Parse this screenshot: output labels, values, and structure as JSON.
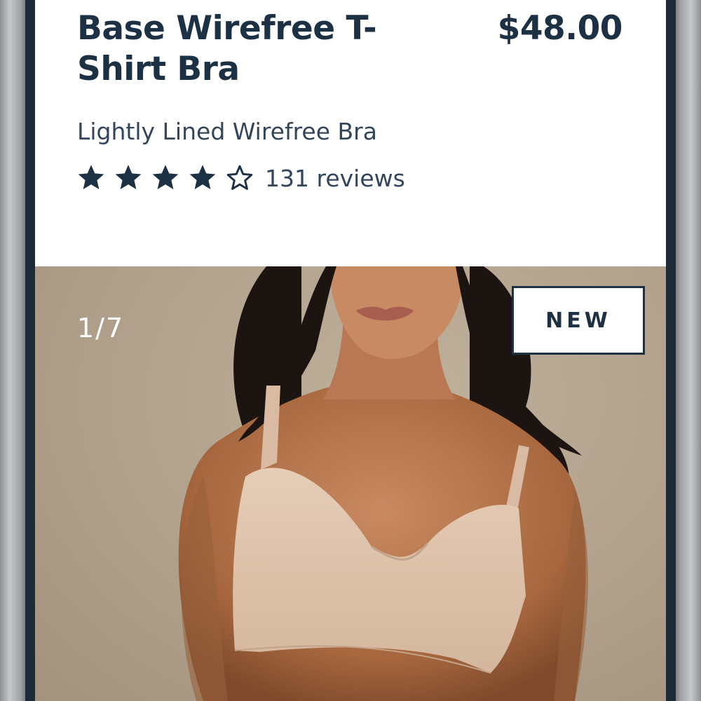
{
  "product": {
    "title": "Base Wirefree T-Shirt Bra",
    "price": "$48.00",
    "subtitle": "Lightly Lined Wirefree Bra",
    "rating": {
      "value": 4,
      "max": 5,
      "reviews_label": "131 reviews"
    }
  },
  "gallery": {
    "counter": "1/7",
    "current_image": 1,
    "total_images": 7,
    "badge": "NEW",
    "image_icon": "model-wearing-bra-photo"
  },
  "colors": {
    "text_primary": "#1d3145",
    "text_secondary": "#33455a",
    "star_filled": "#1d3145",
    "badge_border": "#1d3145",
    "frame_border": "#1f2a38",
    "photo_background": "#b1a18c"
  }
}
